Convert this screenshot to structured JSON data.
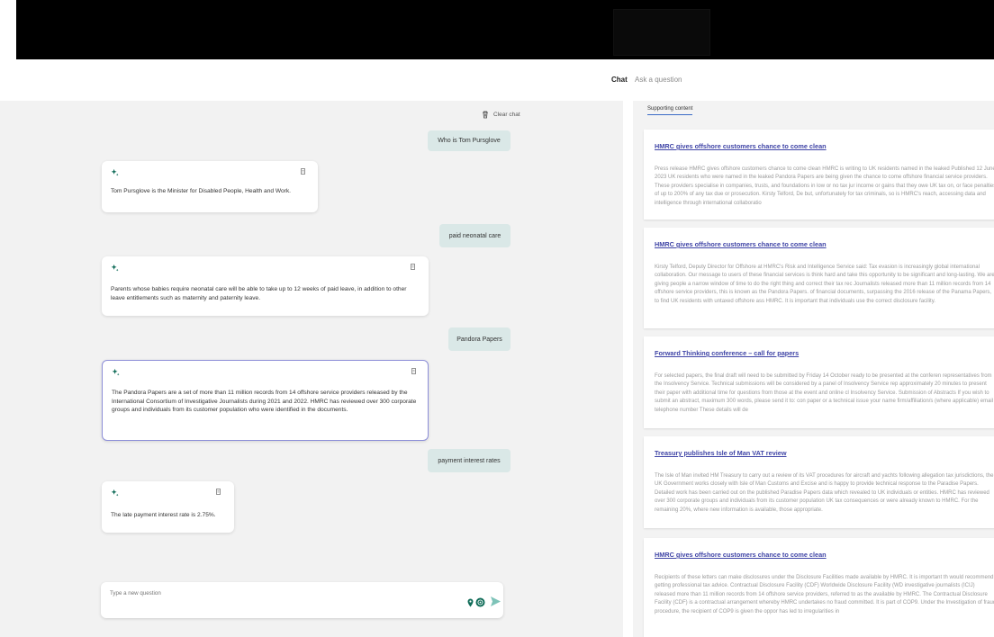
{
  "nav": {
    "chat_label": "Chat",
    "ask_label": "Ask a question"
  },
  "chat": {
    "clear_label": "Clear chat",
    "messages": [
      {
        "role": "user",
        "text": "Who is Tom Pursglove"
      },
      {
        "role": "assistant",
        "text": "Tom Pursglove is the Minister for Disabled People, Health and Work."
      },
      {
        "role": "user",
        "text": "paid neonatal care"
      },
      {
        "role": "assistant",
        "text": "Parents whose babies require neonatal care will be able to take up to 12 weeks of paid leave, in addition to other leave entitlements such as maternity and paternity leave."
      },
      {
        "role": "user",
        "text": "Pandora Papers"
      },
      {
        "role": "assistant",
        "text": "The Pandora Papers are a set of more than 11 million records from 14 offshore service providers released by the International Consortium of Investigative Journalists during 2021 and 2022. HMRC has reviewed over 300 corporate groups and individuals from its customer population who were identified in the documents."
      },
      {
        "role": "user",
        "text": "payment interest rates"
      },
      {
        "role": "assistant",
        "text": "The late payment interest rate is 2.75%."
      }
    ],
    "input_placeholder": "Type a new question"
  },
  "supporting": {
    "tab_label": "Supporting content",
    "cards": [
      {
        "title": "HMRC gives offshore customers chance to come clean",
        "body": "Press release HMRC gives offshore customers chance to come clean HMRC is writing to UK residents named in the leaked Published 12 June 2023 UK residents who were named in the leaked Pandora Papers are being given the chance to come offshore financial service providers. These providers specialise in companies, trusts, and foundations in low or no tax jur income or gains that they owe UK tax on, or face penalties of up to 200% of any tax due or prosecution. Kirsty Telford, De but, unfortunately for tax criminals, so is HMRC's reach, accessing data and intelligence through international collaboratio"
      },
      {
        "title": "HMRC gives offshore customers chance to come clean",
        "body": "Kirsty Telford, Deputy Director for Offshore at HMRC's Risk and Intelligence Service said: Tax evasion is increasingly global international collaboration. Our message to users of these financial services is think hard and take this opportunity to be significant and long-lasting. We are giving people a narrow window of time to do the right thing and correct their tax rec Journalists released more than 11 million records from 14 offshore service providers, this is known as the Pandora Papers. of financial documents, surpassing the 2016 release of the Panama Papers, to find UK residents with untaxed offshore ass HMRC. It is important that individuals use the correct disclosure facility."
      },
      {
        "title": "Forward Thinking conference – call for papers",
        "body": "For selected papers, the final draft will need to be submitted by Friday 14 October ready to be presented at the conferen representatives from the Insolvency Service. Technical submissions will be considered by a panel of Insolvency Service rep approximately 20 minutes to present their paper with additional time for questions from those at the event and online cl Insolvency Service. Submission of Abstracts If you wish to submit an abstract, maximum 300 words, please send it to: con paper or a technical issue your name firm/affiliation/s (where applicable) email telephone number These details will de"
      },
      {
        "title": "Treasury publishes Isle of Man VAT review",
        "body": "The Isle of Man invited HM Treasury to carry out a review of its VAT procedures for aircraft and yachts following allegation tax jurisdictions, the UK Government works closely with Isle of Man Customs and Excise and is happy to provide technical response to the Paradise Papers. Detailed work has been carried out on the published Paradise Papers data which revealed to UK individuals or entities. HMRC has reviewed over 300 corporate groups and individuals from its customer population UK tax consequences or were already known to HMRC. For the remaining 20%, where new information is available, those appropriate."
      },
      {
        "title": "HMRC gives offshore customers chance to come clean",
        "body": "Recipients of these letters can make disclosures under the Disclosure Facilities made available by HMRC. It is important th would recommend getting professional tax advice. Contractual Disclosure Facility (CDF) Worldwide Disclosure Facility (WD investigative journalists (ICIJ) released more than 11 million records from 14 offshore service providers, referred to as the available by HMRC. The Contractual Disclosure Facility (CDF) is a contractual arrangement whereby HMRC undertakes no fraud committed. It is part of COP9. Under the Investigation of fraud procedure, the recipient of COP9 is given the oppor has led to irregularities in"
      }
    ]
  },
  "colors": {
    "accent": "#3f44a6",
    "user_bubble": "#dae8e7",
    "send": "#7ec3b8",
    "icon_green": "#0e6b57"
  }
}
